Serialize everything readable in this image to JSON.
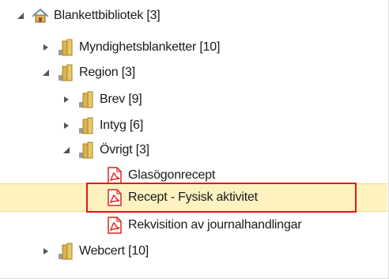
{
  "tree": {
    "root": {
      "label": "Blankettbibliotek [3]",
      "icon": "home-icon",
      "expanded": true
    },
    "items": [
      {
        "label": "Myndighetsblanketter [10]",
        "icon": "folder-icon",
        "expanded": false
      },
      {
        "label": "Region [3]",
        "icon": "folder-icon",
        "expanded": true
      },
      {
        "label": "Brev [9]",
        "icon": "folder-icon",
        "expanded": false
      },
      {
        "label": "Intyg [6]",
        "icon": "folder-icon",
        "expanded": false
      },
      {
        "label": "Övrigt [3]",
        "icon": "folder-icon",
        "expanded": true
      },
      {
        "label": "Glasögonrecept",
        "icon": "pdf-icon"
      },
      {
        "label": "Recept - Fysisk aktivitet",
        "icon": "pdf-icon",
        "selected": true
      },
      {
        "label": "Rekvisition av journalhandlingar",
        "icon": "pdf-icon"
      },
      {
        "label": "Webcert [10]",
        "icon": "folder-icon",
        "expanded": false
      }
    ]
  },
  "colors": {
    "selected_row": "#fdf2c0",
    "highlight_border": "#e8141b",
    "pdf_red": "#d8261c",
    "folder_gold": "#c9a23a"
  }
}
